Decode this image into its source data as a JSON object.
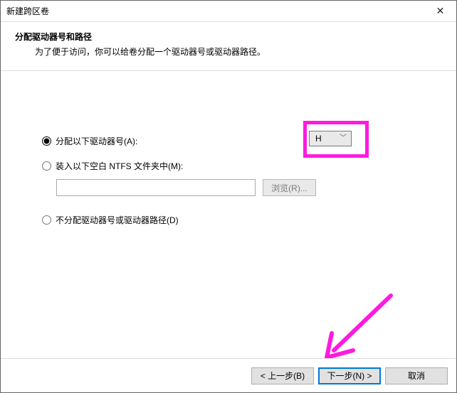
{
  "titlebar": {
    "title": "新建跨区卷"
  },
  "header": {
    "title": "分配驱动器号和路径",
    "desc": "为了便于访问，你可以给卷分配一个驱动器号或驱动器路径。"
  },
  "options": {
    "assign": {
      "label": "分配以下驱动器号(A):",
      "checked": true,
      "drive": "H"
    },
    "mount": {
      "label": "装入以下空白 NTFS 文件夹中(M):",
      "checked": false,
      "path": "",
      "browse_label": "浏览(R)..."
    },
    "none": {
      "label": "不分配驱动器号或驱动器路径(D)",
      "checked": false
    }
  },
  "footer": {
    "back": "< 上一步(B)",
    "next": "下一步(N) >",
    "cancel": "取消"
  },
  "colors": {
    "highlight": "#ff1ae0",
    "accent": "#0078d7"
  }
}
